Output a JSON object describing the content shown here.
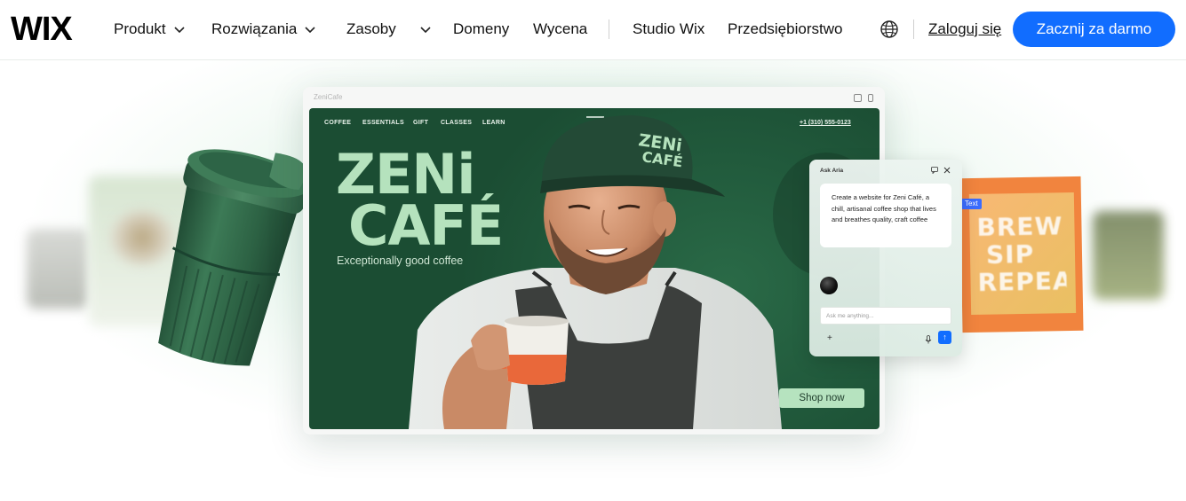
{
  "header": {
    "logo": "WIX",
    "nav": [
      {
        "label": "Produkt",
        "has_dropdown": true
      },
      {
        "label": "Rozwiązania",
        "has_dropdown": true
      },
      {
        "label": "Zasoby",
        "has_dropdown": true
      },
      {
        "label": "Domeny",
        "has_dropdown": false
      },
      {
        "label": "Wycena",
        "has_dropdown": false
      },
      {
        "label": "Studio Wix",
        "has_dropdown": false
      },
      {
        "label": "Przedsiębiorstwo",
        "has_dropdown": false
      }
    ],
    "globe_icon": "globe-icon",
    "login_label": "Zaloguj się",
    "cta_label": "Zacznij za darmo",
    "cta_color": "#116dff"
  },
  "hero": {
    "browser": {
      "url": "ZeniCafe",
      "site": {
        "nav": [
          "COFFEE",
          "ESSENTIALS",
          "GIFT",
          "CLASSES",
          "LEARN"
        ],
        "phone": "+1 (310) 555-0123",
        "brand_line1": "ZENi",
        "brand_line2": "CAFÉ",
        "tagline": "Exceptionally good coffee",
        "shop_label": "Shop now",
        "cap_line1": "ZENi",
        "cap_line2": "CAFÉ",
        "accent_green": "#b5e2bd",
        "bg_green": "#215a3c"
      }
    },
    "aria": {
      "title": "Ask Aria",
      "message": "Create a website for Zeni Café, a chill, artisanal coffee shop that lives and breathes quality, craft coffee",
      "input_placeholder": "Ask me anything...",
      "plus": "+",
      "send": "↑"
    },
    "brew_card": {
      "tag": "Text",
      "line1": "BREW",
      "line2": "SIP",
      "line3": "REPEAT",
      "color": "#f1843e"
    }
  }
}
